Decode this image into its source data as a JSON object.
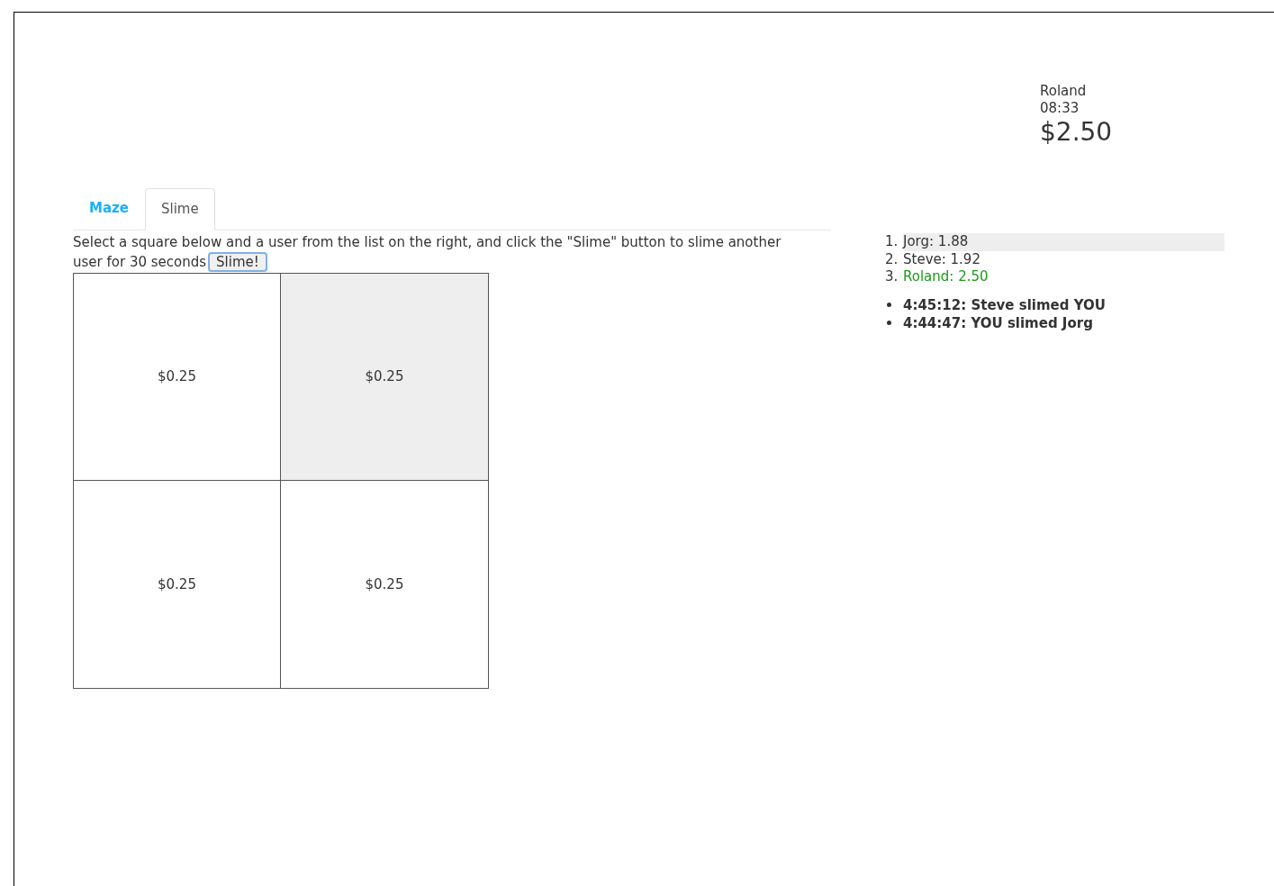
{
  "header": {
    "name": "Roland",
    "time": "08:33",
    "balance": "$2.50"
  },
  "tabs": [
    {
      "label": "Maze",
      "selected": false
    },
    {
      "label": "Slime",
      "selected": true
    }
  ],
  "instructions": [
    "Select a square below and a user from the list on the right, and click the \"Slime\" button to slime another",
    "user for 30 seconds"
  ],
  "slime_button": "Slime!",
  "squares": [
    {
      "label": "$0.25",
      "selected": false
    },
    {
      "label": "$0.25",
      "selected": true
    },
    {
      "label": "$0.25",
      "selected": false
    },
    {
      "label": "$0.25",
      "selected": false
    }
  ],
  "leaderboard": [
    {
      "rank": "1.",
      "entry": "Jorg: 1.88",
      "selected": true,
      "is_you": false
    },
    {
      "rank": "2.",
      "entry": "Steve: 1.92",
      "selected": false,
      "is_you": false
    },
    {
      "rank": "3.",
      "entry": "Roland: 2.50",
      "selected": false,
      "is_you": true
    }
  ],
  "events": [
    "4:45:12: Steve slimed YOU",
    "4:44:47: YOU slimed Jorg"
  ]
}
